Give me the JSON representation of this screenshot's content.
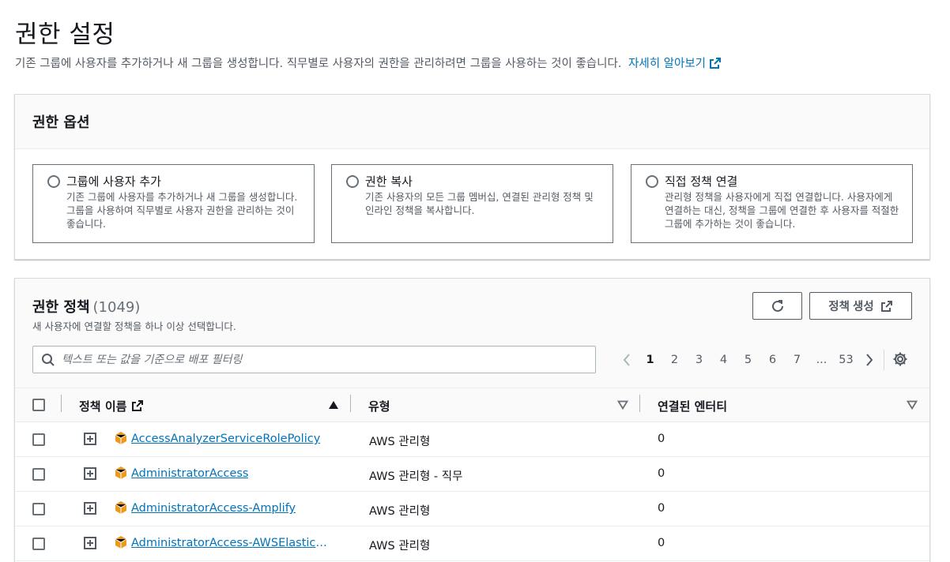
{
  "page": {
    "title": "권한 설정",
    "description": "기존 그룹에 사용자를 추가하거나 새 그룹을 생성합니다. 직무별로 사용자의 권한을 관리하려면 그룹을 사용하는 것이 좋습니다.",
    "learn_more": "자세히 알아보기"
  },
  "options": {
    "title": "권한 옵션",
    "items": [
      {
        "label": "그룹에 사용자 추가",
        "desc": "기존 그룹에 사용자를 추가하거나 새 그룹을 생성합니다. 그룹을 사용하여 직무별로 사용자 권한을 관리하는 것이 좋습니다.",
        "selected": false
      },
      {
        "label": "권한 복사",
        "desc": "기존 사용자의 모든 그룹 멤버십, 연결된 관리형 정책 및 인라인 정책을 복사합니다.",
        "selected": false
      },
      {
        "label": "직접 정책 연결",
        "desc": "관리형 정책을 사용자에게 직접 연결합니다. 사용자에게 연결하는 대신, 정책을 그룹에 연결한 후 사용자를 적절한 그룹에 추가하는 것이 좋습니다.",
        "selected": true
      }
    ]
  },
  "policies": {
    "title": "권한 정책",
    "count": "(1049)",
    "subtitle": "새 사용자에 연결할 정책을 하나 이상 선택합니다.",
    "create_label": "정책 생성",
    "search_placeholder": "텍스트 또는 값을 기준으로 배포 필터링",
    "pages": [
      "1",
      "2",
      "3",
      "4",
      "5",
      "6",
      "7",
      "...",
      "53"
    ],
    "current_page": "1",
    "columns": {
      "name": "정책 이름",
      "type": "유형",
      "entities": "연결된 엔터티"
    },
    "rows": [
      {
        "name": "AccessAnalyzerServiceRolePolicy",
        "type": "AWS 관리형",
        "entities": "0"
      },
      {
        "name": "AdministratorAccess",
        "type": "AWS 관리형 - 직무",
        "entities": "0"
      },
      {
        "name": "AdministratorAccess-Amplify",
        "type": "AWS 관리형",
        "entities": "0"
      },
      {
        "name": "AdministratorAccess-AWSElasticBeanstalk",
        "type": "AWS 관리형",
        "entities": "0"
      }
    ]
  },
  "colors": {
    "link": "#0073bb",
    "selected_border": "#00a1c9",
    "selected_bg": "#f1faff",
    "icon_orange": "#ec9a1c"
  },
  "icons": [
    "external-link-icon",
    "refresh-icon",
    "search-icon",
    "chevron-left-icon",
    "chevron-right-icon",
    "settings-icon",
    "sort-up-icon",
    "sort-down-icon",
    "expand-icon",
    "policy-cube-icon"
  ]
}
